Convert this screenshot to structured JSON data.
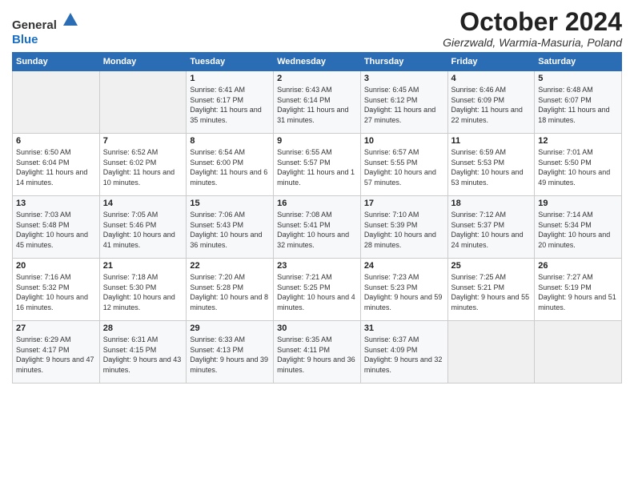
{
  "header": {
    "logo_general": "General",
    "logo_blue": "Blue",
    "title": "October 2024",
    "subtitle": "Gierzwald, Warmia-Masuria, Poland"
  },
  "weekdays": [
    "Sunday",
    "Monday",
    "Tuesday",
    "Wednesday",
    "Thursday",
    "Friday",
    "Saturday"
  ],
  "weeks": [
    [
      {
        "day": "",
        "sunrise": "",
        "sunset": "",
        "daylight": ""
      },
      {
        "day": "",
        "sunrise": "",
        "sunset": "",
        "daylight": ""
      },
      {
        "day": "1",
        "sunrise": "Sunrise: 6:41 AM",
        "sunset": "Sunset: 6:17 PM",
        "daylight": "Daylight: 11 hours and 35 minutes."
      },
      {
        "day": "2",
        "sunrise": "Sunrise: 6:43 AM",
        "sunset": "Sunset: 6:14 PM",
        "daylight": "Daylight: 11 hours and 31 minutes."
      },
      {
        "day": "3",
        "sunrise": "Sunrise: 6:45 AM",
        "sunset": "Sunset: 6:12 PM",
        "daylight": "Daylight: 11 hours and 27 minutes."
      },
      {
        "day": "4",
        "sunrise": "Sunrise: 6:46 AM",
        "sunset": "Sunset: 6:09 PM",
        "daylight": "Daylight: 11 hours and 22 minutes."
      },
      {
        "day": "5",
        "sunrise": "Sunrise: 6:48 AM",
        "sunset": "Sunset: 6:07 PM",
        "daylight": "Daylight: 11 hours and 18 minutes."
      }
    ],
    [
      {
        "day": "6",
        "sunrise": "Sunrise: 6:50 AM",
        "sunset": "Sunset: 6:04 PM",
        "daylight": "Daylight: 11 hours and 14 minutes."
      },
      {
        "day": "7",
        "sunrise": "Sunrise: 6:52 AM",
        "sunset": "Sunset: 6:02 PM",
        "daylight": "Daylight: 11 hours and 10 minutes."
      },
      {
        "day": "8",
        "sunrise": "Sunrise: 6:54 AM",
        "sunset": "Sunset: 6:00 PM",
        "daylight": "Daylight: 11 hours and 6 minutes."
      },
      {
        "day": "9",
        "sunrise": "Sunrise: 6:55 AM",
        "sunset": "Sunset: 5:57 PM",
        "daylight": "Daylight: 11 hours and 1 minute."
      },
      {
        "day": "10",
        "sunrise": "Sunrise: 6:57 AM",
        "sunset": "Sunset: 5:55 PM",
        "daylight": "Daylight: 10 hours and 57 minutes."
      },
      {
        "day": "11",
        "sunrise": "Sunrise: 6:59 AM",
        "sunset": "Sunset: 5:53 PM",
        "daylight": "Daylight: 10 hours and 53 minutes."
      },
      {
        "day": "12",
        "sunrise": "Sunrise: 7:01 AM",
        "sunset": "Sunset: 5:50 PM",
        "daylight": "Daylight: 10 hours and 49 minutes."
      }
    ],
    [
      {
        "day": "13",
        "sunrise": "Sunrise: 7:03 AM",
        "sunset": "Sunset: 5:48 PM",
        "daylight": "Daylight: 10 hours and 45 minutes."
      },
      {
        "day": "14",
        "sunrise": "Sunrise: 7:05 AM",
        "sunset": "Sunset: 5:46 PM",
        "daylight": "Daylight: 10 hours and 41 minutes."
      },
      {
        "day": "15",
        "sunrise": "Sunrise: 7:06 AM",
        "sunset": "Sunset: 5:43 PM",
        "daylight": "Daylight: 10 hours and 36 minutes."
      },
      {
        "day": "16",
        "sunrise": "Sunrise: 7:08 AM",
        "sunset": "Sunset: 5:41 PM",
        "daylight": "Daylight: 10 hours and 32 minutes."
      },
      {
        "day": "17",
        "sunrise": "Sunrise: 7:10 AM",
        "sunset": "Sunset: 5:39 PM",
        "daylight": "Daylight: 10 hours and 28 minutes."
      },
      {
        "day": "18",
        "sunrise": "Sunrise: 7:12 AM",
        "sunset": "Sunset: 5:37 PM",
        "daylight": "Daylight: 10 hours and 24 minutes."
      },
      {
        "day": "19",
        "sunrise": "Sunrise: 7:14 AM",
        "sunset": "Sunset: 5:34 PM",
        "daylight": "Daylight: 10 hours and 20 minutes."
      }
    ],
    [
      {
        "day": "20",
        "sunrise": "Sunrise: 7:16 AM",
        "sunset": "Sunset: 5:32 PM",
        "daylight": "Daylight: 10 hours and 16 minutes."
      },
      {
        "day": "21",
        "sunrise": "Sunrise: 7:18 AM",
        "sunset": "Sunset: 5:30 PM",
        "daylight": "Daylight: 10 hours and 12 minutes."
      },
      {
        "day": "22",
        "sunrise": "Sunrise: 7:20 AM",
        "sunset": "Sunset: 5:28 PM",
        "daylight": "Daylight: 10 hours and 8 minutes."
      },
      {
        "day": "23",
        "sunrise": "Sunrise: 7:21 AM",
        "sunset": "Sunset: 5:25 PM",
        "daylight": "Daylight: 10 hours and 4 minutes."
      },
      {
        "day": "24",
        "sunrise": "Sunrise: 7:23 AM",
        "sunset": "Sunset: 5:23 PM",
        "daylight": "Daylight: 9 hours and 59 minutes."
      },
      {
        "day": "25",
        "sunrise": "Sunrise: 7:25 AM",
        "sunset": "Sunset: 5:21 PM",
        "daylight": "Daylight: 9 hours and 55 minutes."
      },
      {
        "day": "26",
        "sunrise": "Sunrise: 7:27 AM",
        "sunset": "Sunset: 5:19 PM",
        "daylight": "Daylight: 9 hours and 51 minutes."
      }
    ],
    [
      {
        "day": "27",
        "sunrise": "Sunrise: 6:29 AM",
        "sunset": "Sunset: 4:17 PM",
        "daylight": "Daylight: 9 hours and 47 minutes."
      },
      {
        "day": "28",
        "sunrise": "Sunrise: 6:31 AM",
        "sunset": "Sunset: 4:15 PM",
        "daylight": "Daylight: 9 hours and 43 minutes."
      },
      {
        "day": "29",
        "sunrise": "Sunrise: 6:33 AM",
        "sunset": "Sunset: 4:13 PM",
        "daylight": "Daylight: 9 hours and 39 minutes."
      },
      {
        "day": "30",
        "sunrise": "Sunrise: 6:35 AM",
        "sunset": "Sunset: 4:11 PM",
        "daylight": "Daylight: 9 hours and 36 minutes."
      },
      {
        "day": "31",
        "sunrise": "Sunrise: 6:37 AM",
        "sunset": "Sunset: 4:09 PM",
        "daylight": "Daylight: 9 hours and 32 minutes."
      },
      {
        "day": "",
        "sunrise": "",
        "sunset": "",
        "daylight": ""
      },
      {
        "day": "",
        "sunrise": "",
        "sunset": "",
        "daylight": ""
      }
    ]
  ]
}
